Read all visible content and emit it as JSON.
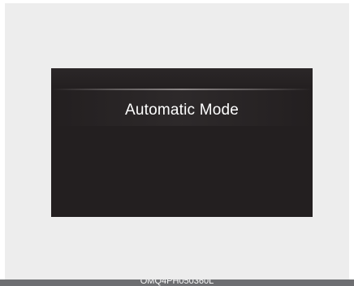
{
  "display": {
    "title": "Automatic Mode"
  },
  "footer": {
    "code": "OMQ4PH050360L"
  },
  "colors": {
    "page_background": "#ededed",
    "screen_background": "#231f20",
    "title_text": "#ffffff",
    "footer_bar": "#6d6e71"
  }
}
